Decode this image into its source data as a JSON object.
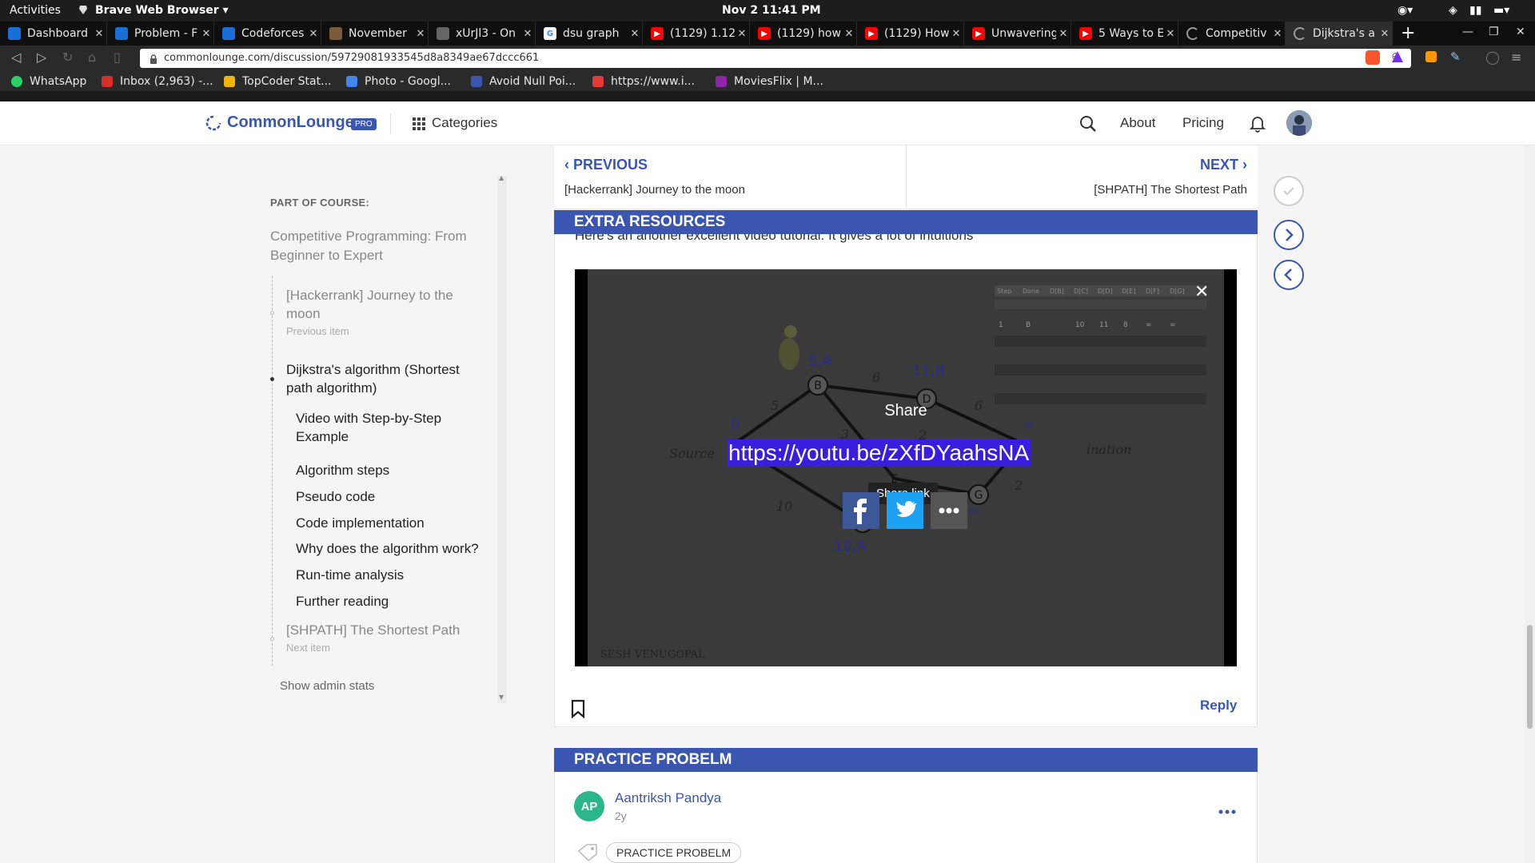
{
  "system_bar": {
    "activities": "Activities",
    "app_name": "Brave Web Browser",
    "datetime": "Nov 2  11:41 PM"
  },
  "tabs": [
    {
      "label": "Dashboard",
      "icon": "codeforces-icon",
      "color": "#1a6ed8"
    },
    {
      "label": "Problem - F",
      "icon": "codeforces-icon",
      "color": "#1a6ed8"
    },
    {
      "label": "Codeforces",
      "icon": "codeforces-icon",
      "color": "#1a6ed8"
    },
    {
      "label": "November",
      "icon": "codechef-icon",
      "color": "#7a5b3a"
    },
    {
      "label": "xUrJl3 - On",
      "icon": "site-icon",
      "color": "#666666"
    },
    {
      "label": "dsu graph",
      "icon": "google-icon",
      "color": "#ffffff"
    },
    {
      "label": "(1129) 1.12",
      "icon": "youtube-icon",
      "color": "#ff0000"
    },
    {
      "label": "(1129) how",
      "icon": "youtube-icon",
      "color": "#ff0000"
    },
    {
      "label": "(1129) How",
      "icon": "youtube-icon",
      "color": "#ff0000"
    },
    {
      "label": "Unwavering",
      "icon": "youtube-icon",
      "color": "#ff0000"
    },
    {
      "label": "5 Ways to E",
      "icon": "youtube-icon",
      "color": "#ff0000"
    },
    {
      "label": "Competitiv",
      "icon": "loading-icon",
      "color": "#999999"
    },
    {
      "label": "Dijkstra's a",
      "icon": "loading-icon",
      "color": "#999999",
      "active": true
    }
  ],
  "address_bar": {
    "url": "commonlounge.com/discussion/59729081933545d8a8349ae67dccc661"
  },
  "bookmarks": [
    {
      "label": "WhatsApp",
      "color": "#25d366"
    },
    {
      "label": "Inbox (2,963) -...",
      "color": "#d93025"
    },
    {
      "label": "TopCoder Stat...",
      "color": "#f5b400"
    },
    {
      "label": "Photo - Googl...",
      "color": "#4285f4"
    },
    {
      "label": "Avoid Null Poi...",
      "color": "#3a56b0"
    },
    {
      "label": "https://www.i...",
      "color": "#e53935"
    },
    {
      "label": "MoviesFlix | M...",
      "color": "#8e24aa"
    }
  ],
  "site_header": {
    "logo": "CommonLounge",
    "badge": "PRO",
    "categories": "Categories",
    "about": "About",
    "pricing": "Pricing"
  },
  "sidebar": {
    "part_of_course": "PART OF COURSE:",
    "course_title_line1": "Competitive Programming: From",
    "course_title_line2": "Beginner to Expert",
    "prev_title_line1": "[Hackerrank] Journey to the",
    "prev_title_line2": "moon",
    "prev_caption": "Previous item",
    "current_line1": "Dijkstra's algorithm (Shortest",
    "current_line2": "path algorithm)",
    "sections": [
      "Video with Step-by-Step",
      "Example",
      "Algorithm steps",
      "Pseudo code",
      "Code implementation",
      "Why does the algorithm work?",
      "Run-time analysis",
      "Further reading"
    ],
    "next_title": "[SHPATH] The Shortest Path",
    "next_caption": "Next item",
    "admin": "Show admin stats"
  },
  "nav": {
    "previous_label": "PREVIOUS",
    "previous_title": "[Hackerrank] Journey to the moon",
    "next_label": "NEXT",
    "next_title": "[SHPATH] The Shortest Path"
  },
  "extra_resources": {
    "heading": "EXTRA RESOURCES",
    "intro": "Here's an another excellent video tutorial. It gives a lot of intuitions",
    "share_title": "Share",
    "share_url": "https://youtu.be/zXfDYaahsNA",
    "tooltip": "Share link",
    "watermark": "SESH VENUGOPAL",
    "reply": "Reply"
  },
  "video_graph": {
    "source_label": "Source",
    "destination_label": "ination",
    "node_labels": [
      "0",
      "5,A",
      "11,B",
      "10,A",
      "∞",
      "∞"
    ],
    "edge_weights": [
      "5",
      "6",
      "6",
      "10",
      "3",
      "2",
      "2"
    ],
    "nodes": [
      "A",
      "B",
      "C",
      "D",
      "E",
      "G"
    ],
    "table_header": [
      "Step",
      "Done",
      "D[B]",
      "D[C]",
      "D[D]",
      "D[E]",
      "D[F]",
      "D[G]"
    ],
    "table_row1": [
      "1",
      "B",
      "",
      "10",
      "11",
      "8",
      "∞",
      "∞"
    ]
  },
  "practice": {
    "heading": "PRACTICE PROBELM",
    "avatar_initials": "AP",
    "author": "Aantriksh Pandya",
    "time": "2y",
    "tag": "PRACTICE PROBELM"
  }
}
